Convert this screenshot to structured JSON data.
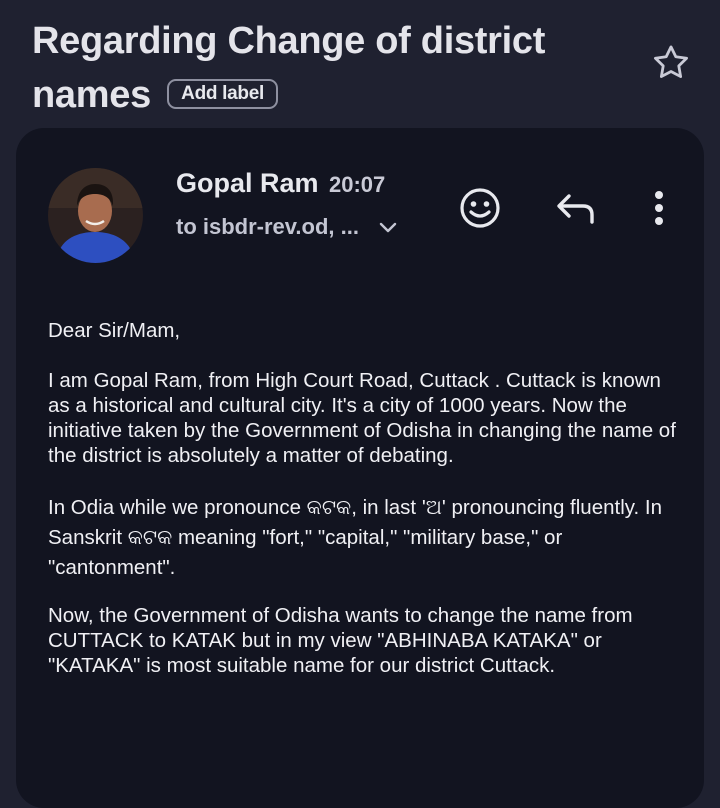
{
  "email": {
    "subject": "Regarding Change of district names",
    "subject_line1": "Regarding Change of district",
    "subject_line2": "names",
    "add_label": "Add label",
    "sender_name": "Gopal Ram",
    "time": "20:07",
    "recipient": "to isbdr-rev.od, ...",
    "body": [
      "Dear Sir/Mam,",
      "I am Gopal Ram, from High Court Road, Cuttack . Cuttack is known as a historical and cultural city. It's a city of 1000 years. Now the initiative taken by the Government of Odisha in changing the name of the district is absolutely a matter of debating.",
      "In Odia while we pronounce କଟକ, in last  'ଅ' pronouncing fluently. In Sanskrit କଟକ meaning \"fort,\" \"capital,\" \"military base,\" or \"cantonment\".",
      "Now, the Government of Odisha wants to change the name from CUTTACK to KATAK but in my view \"ABHINABA KATAKA\" or \"KATAKA\" is most suitable name for our district Cuttack."
    ]
  },
  "icons": {
    "star": "star-outline-icon",
    "emoji": "smiley-icon",
    "reply": "reply-arrow-icon",
    "more": "more-vertical-icon",
    "expand": "chevron-down-icon"
  },
  "colors": {
    "background": "#1f2130",
    "card": "#121420",
    "text": "#e8e9ee"
  }
}
